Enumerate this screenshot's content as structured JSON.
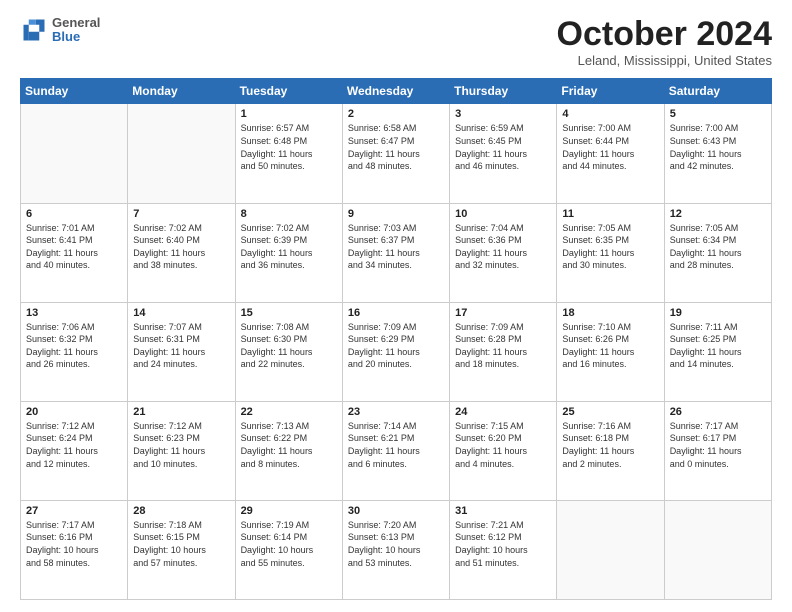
{
  "header": {
    "logo_general": "General",
    "logo_blue": "Blue",
    "month_title": "October 2024",
    "location": "Leland, Mississippi, United States"
  },
  "days_of_week": [
    "Sunday",
    "Monday",
    "Tuesday",
    "Wednesday",
    "Thursday",
    "Friday",
    "Saturday"
  ],
  "weeks": [
    [
      {
        "day": "",
        "detail": ""
      },
      {
        "day": "",
        "detail": ""
      },
      {
        "day": "1",
        "detail": "Sunrise: 6:57 AM\nSunset: 6:48 PM\nDaylight: 11 hours\nand 50 minutes."
      },
      {
        "day": "2",
        "detail": "Sunrise: 6:58 AM\nSunset: 6:47 PM\nDaylight: 11 hours\nand 48 minutes."
      },
      {
        "day": "3",
        "detail": "Sunrise: 6:59 AM\nSunset: 6:45 PM\nDaylight: 11 hours\nand 46 minutes."
      },
      {
        "day": "4",
        "detail": "Sunrise: 7:00 AM\nSunset: 6:44 PM\nDaylight: 11 hours\nand 44 minutes."
      },
      {
        "day": "5",
        "detail": "Sunrise: 7:00 AM\nSunset: 6:43 PM\nDaylight: 11 hours\nand 42 minutes."
      }
    ],
    [
      {
        "day": "6",
        "detail": "Sunrise: 7:01 AM\nSunset: 6:41 PM\nDaylight: 11 hours\nand 40 minutes."
      },
      {
        "day": "7",
        "detail": "Sunrise: 7:02 AM\nSunset: 6:40 PM\nDaylight: 11 hours\nand 38 minutes."
      },
      {
        "day": "8",
        "detail": "Sunrise: 7:02 AM\nSunset: 6:39 PM\nDaylight: 11 hours\nand 36 minutes."
      },
      {
        "day": "9",
        "detail": "Sunrise: 7:03 AM\nSunset: 6:37 PM\nDaylight: 11 hours\nand 34 minutes."
      },
      {
        "day": "10",
        "detail": "Sunrise: 7:04 AM\nSunset: 6:36 PM\nDaylight: 11 hours\nand 32 minutes."
      },
      {
        "day": "11",
        "detail": "Sunrise: 7:05 AM\nSunset: 6:35 PM\nDaylight: 11 hours\nand 30 minutes."
      },
      {
        "day": "12",
        "detail": "Sunrise: 7:05 AM\nSunset: 6:34 PM\nDaylight: 11 hours\nand 28 minutes."
      }
    ],
    [
      {
        "day": "13",
        "detail": "Sunrise: 7:06 AM\nSunset: 6:32 PM\nDaylight: 11 hours\nand 26 minutes."
      },
      {
        "day": "14",
        "detail": "Sunrise: 7:07 AM\nSunset: 6:31 PM\nDaylight: 11 hours\nand 24 minutes."
      },
      {
        "day": "15",
        "detail": "Sunrise: 7:08 AM\nSunset: 6:30 PM\nDaylight: 11 hours\nand 22 minutes."
      },
      {
        "day": "16",
        "detail": "Sunrise: 7:09 AM\nSunset: 6:29 PM\nDaylight: 11 hours\nand 20 minutes."
      },
      {
        "day": "17",
        "detail": "Sunrise: 7:09 AM\nSunset: 6:28 PM\nDaylight: 11 hours\nand 18 minutes."
      },
      {
        "day": "18",
        "detail": "Sunrise: 7:10 AM\nSunset: 6:26 PM\nDaylight: 11 hours\nand 16 minutes."
      },
      {
        "day": "19",
        "detail": "Sunrise: 7:11 AM\nSunset: 6:25 PM\nDaylight: 11 hours\nand 14 minutes."
      }
    ],
    [
      {
        "day": "20",
        "detail": "Sunrise: 7:12 AM\nSunset: 6:24 PM\nDaylight: 11 hours\nand 12 minutes."
      },
      {
        "day": "21",
        "detail": "Sunrise: 7:12 AM\nSunset: 6:23 PM\nDaylight: 11 hours\nand 10 minutes."
      },
      {
        "day": "22",
        "detail": "Sunrise: 7:13 AM\nSunset: 6:22 PM\nDaylight: 11 hours\nand 8 minutes."
      },
      {
        "day": "23",
        "detail": "Sunrise: 7:14 AM\nSunset: 6:21 PM\nDaylight: 11 hours\nand 6 minutes."
      },
      {
        "day": "24",
        "detail": "Sunrise: 7:15 AM\nSunset: 6:20 PM\nDaylight: 11 hours\nand 4 minutes."
      },
      {
        "day": "25",
        "detail": "Sunrise: 7:16 AM\nSunset: 6:18 PM\nDaylight: 11 hours\nand 2 minutes."
      },
      {
        "day": "26",
        "detail": "Sunrise: 7:17 AM\nSunset: 6:17 PM\nDaylight: 11 hours\nand 0 minutes."
      }
    ],
    [
      {
        "day": "27",
        "detail": "Sunrise: 7:17 AM\nSunset: 6:16 PM\nDaylight: 10 hours\nand 58 minutes."
      },
      {
        "day": "28",
        "detail": "Sunrise: 7:18 AM\nSunset: 6:15 PM\nDaylight: 10 hours\nand 57 minutes."
      },
      {
        "day": "29",
        "detail": "Sunrise: 7:19 AM\nSunset: 6:14 PM\nDaylight: 10 hours\nand 55 minutes."
      },
      {
        "day": "30",
        "detail": "Sunrise: 7:20 AM\nSunset: 6:13 PM\nDaylight: 10 hours\nand 53 minutes."
      },
      {
        "day": "31",
        "detail": "Sunrise: 7:21 AM\nSunset: 6:12 PM\nDaylight: 10 hours\nand 51 minutes."
      },
      {
        "day": "",
        "detail": ""
      },
      {
        "day": "",
        "detail": ""
      }
    ]
  ]
}
